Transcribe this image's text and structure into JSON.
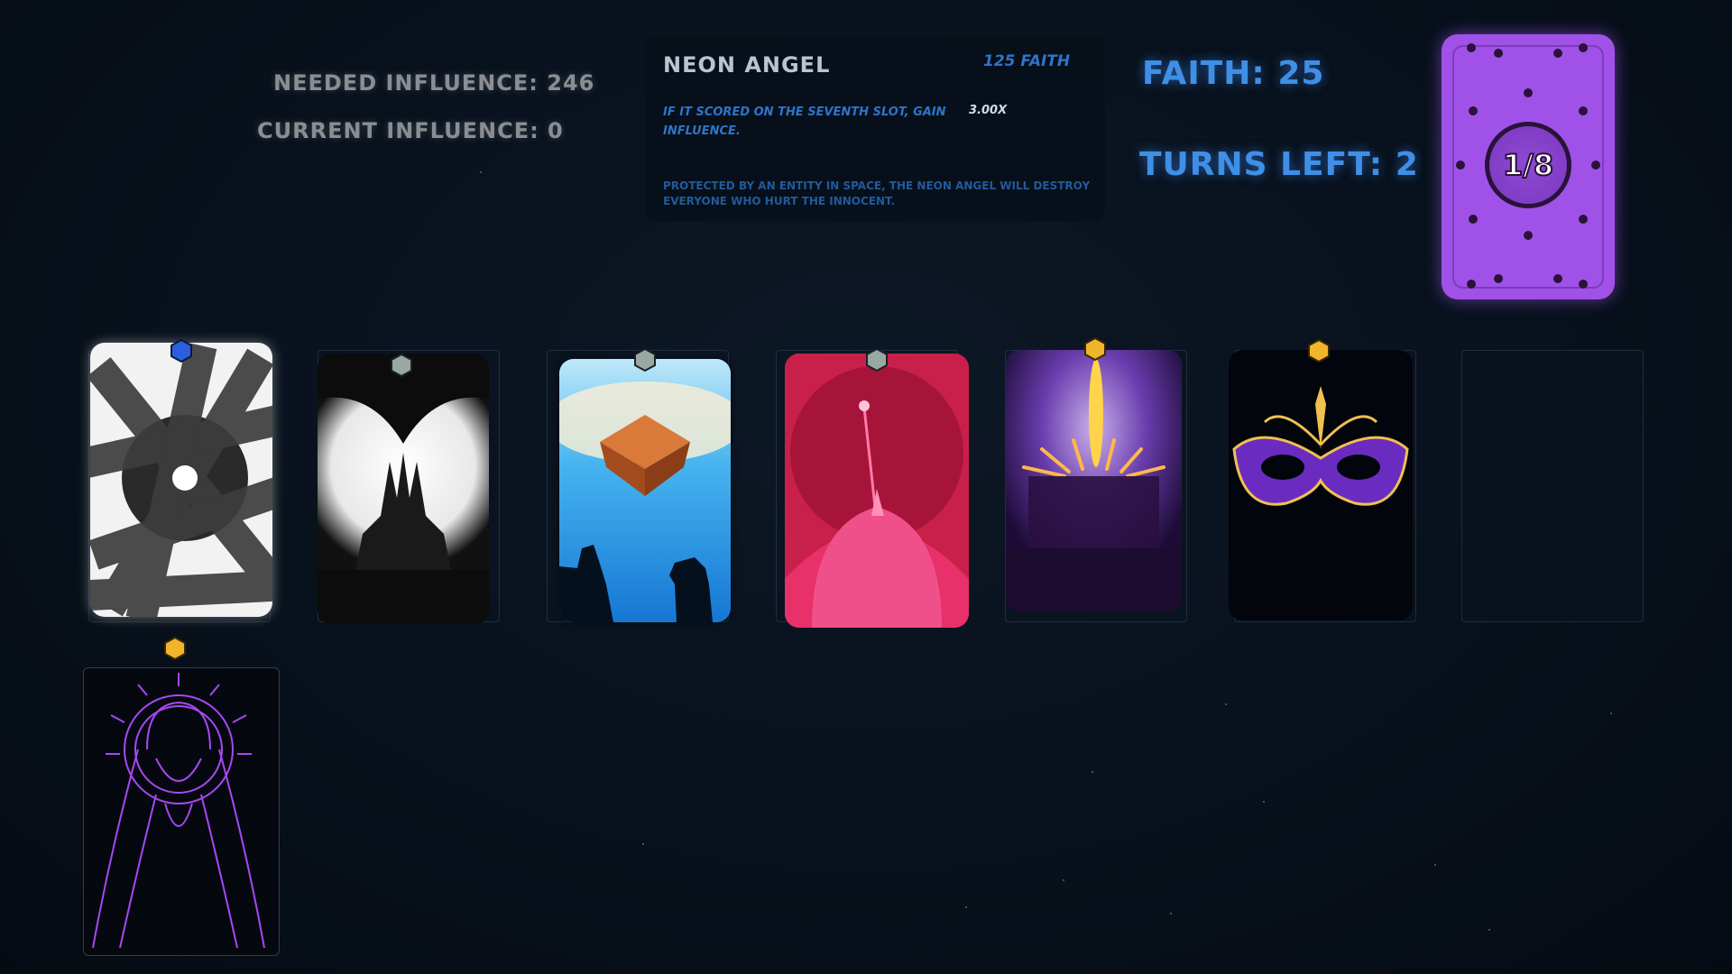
{
  "influence": {
    "needed_label": "NEEDED INFLUENCE: 246",
    "current_label": "CURRENT INFLUENCE: 0"
  },
  "tooltip": {
    "name": "NEON ANGEL",
    "cost": "125 FAITH",
    "effect": "IF IT SCORED ON THE SEVENTH SLOT, GAIN INFLUENCE.",
    "multiplier": "3.00X",
    "lore": "PROTECTED BY AN ENTITY IN SPACE, THE NEON ANGEL WILL DESTROY EVERYONE WHO HURT THE INNOCENT."
  },
  "stats": {
    "faith_label": "FAITH: 25",
    "turns_label": "TURNS LEFT: 2"
  },
  "deck": {
    "count": "1/8",
    "color": "#a052e8"
  },
  "board": {
    "cards": [
      {
        "art": "crossed-strokes-card",
        "gem": "blue-gem-icon"
      },
      {
        "art": "silhouette-card",
        "gem": "gray-gem-icon"
      },
      {
        "art": "floating-cube-card",
        "gem": "gray-gem-icon"
      },
      {
        "art": "red-tower-card",
        "gem": "gray-gem-icon"
      },
      {
        "art": "purple-eye-card",
        "gem": "gold-gem-icon"
      },
      {
        "art": "masquerade-mask-card",
        "gem": "gold-gem-icon"
      }
    ],
    "empty_slot": "empty-slot",
    "hand": [
      {
        "art": "neon-angel-card",
        "gem": "gold-gem-icon"
      }
    ]
  },
  "colors": {
    "gem_blue": "#2c5fe0",
    "gem_gray": "#9aa8a4",
    "gem_gold": "#f0b52a",
    "text_blue": "#3f8fe6"
  }
}
